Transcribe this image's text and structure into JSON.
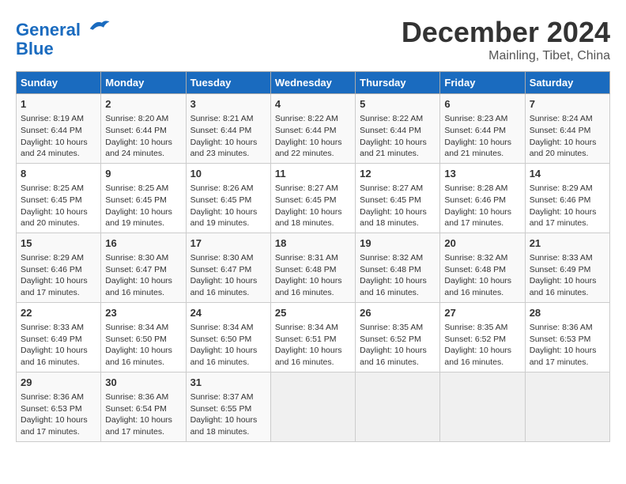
{
  "header": {
    "logo_line1": "General",
    "logo_line2": "Blue",
    "month": "December 2024",
    "location": "Mainling, Tibet, China"
  },
  "weekdays": [
    "Sunday",
    "Monday",
    "Tuesday",
    "Wednesday",
    "Thursday",
    "Friday",
    "Saturday"
  ],
  "weeks": [
    [
      {
        "day": "1",
        "info": "Sunrise: 8:19 AM\nSunset: 6:44 PM\nDaylight: 10 hours and 24 minutes."
      },
      {
        "day": "2",
        "info": "Sunrise: 8:20 AM\nSunset: 6:44 PM\nDaylight: 10 hours and 24 minutes."
      },
      {
        "day": "3",
        "info": "Sunrise: 8:21 AM\nSunset: 6:44 PM\nDaylight: 10 hours and 23 minutes."
      },
      {
        "day": "4",
        "info": "Sunrise: 8:22 AM\nSunset: 6:44 PM\nDaylight: 10 hours and 22 minutes."
      },
      {
        "day": "5",
        "info": "Sunrise: 8:22 AM\nSunset: 6:44 PM\nDaylight: 10 hours and 21 minutes."
      },
      {
        "day": "6",
        "info": "Sunrise: 8:23 AM\nSunset: 6:44 PM\nDaylight: 10 hours and 21 minutes."
      },
      {
        "day": "7",
        "info": "Sunrise: 8:24 AM\nSunset: 6:44 PM\nDaylight: 10 hours and 20 minutes."
      }
    ],
    [
      {
        "day": "8",
        "info": "Sunrise: 8:25 AM\nSunset: 6:45 PM\nDaylight: 10 hours and 20 minutes."
      },
      {
        "day": "9",
        "info": "Sunrise: 8:25 AM\nSunset: 6:45 PM\nDaylight: 10 hours and 19 minutes."
      },
      {
        "day": "10",
        "info": "Sunrise: 8:26 AM\nSunset: 6:45 PM\nDaylight: 10 hours and 19 minutes."
      },
      {
        "day": "11",
        "info": "Sunrise: 8:27 AM\nSunset: 6:45 PM\nDaylight: 10 hours and 18 minutes."
      },
      {
        "day": "12",
        "info": "Sunrise: 8:27 AM\nSunset: 6:45 PM\nDaylight: 10 hours and 18 minutes."
      },
      {
        "day": "13",
        "info": "Sunrise: 8:28 AM\nSunset: 6:46 PM\nDaylight: 10 hours and 17 minutes."
      },
      {
        "day": "14",
        "info": "Sunrise: 8:29 AM\nSunset: 6:46 PM\nDaylight: 10 hours and 17 minutes."
      }
    ],
    [
      {
        "day": "15",
        "info": "Sunrise: 8:29 AM\nSunset: 6:46 PM\nDaylight: 10 hours and 17 minutes."
      },
      {
        "day": "16",
        "info": "Sunrise: 8:30 AM\nSunset: 6:47 PM\nDaylight: 10 hours and 16 minutes."
      },
      {
        "day": "17",
        "info": "Sunrise: 8:30 AM\nSunset: 6:47 PM\nDaylight: 10 hours and 16 minutes."
      },
      {
        "day": "18",
        "info": "Sunrise: 8:31 AM\nSunset: 6:48 PM\nDaylight: 10 hours and 16 minutes."
      },
      {
        "day": "19",
        "info": "Sunrise: 8:32 AM\nSunset: 6:48 PM\nDaylight: 10 hours and 16 minutes."
      },
      {
        "day": "20",
        "info": "Sunrise: 8:32 AM\nSunset: 6:48 PM\nDaylight: 10 hours and 16 minutes."
      },
      {
        "day": "21",
        "info": "Sunrise: 8:33 AM\nSunset: 6:49 PM\nDaylight: 10 hours and 16 minutes."
      }
    ],
    [
      {
        "day": "22",
        "info": "Sunrise: 8:33 AM\nSunset: 6:49 PM\nDaylight: 10 hours and 16 minutes."
      },
      {
        "day": "23",
        "info": "Sunrise: 8:34 AM\nSunset: 6:50 PM\nDaylight: 10 hours and 16 minutes."
      },
      {
        "day": "24",
        "info": "Sunrise: 8:34 AM\nSunset: 6:50 PM\nDaylight: 10 hours and 16 minutes."
      },
      {
        "day": "25",
        "info": "Sunrise: 8:34 AM\nSunset: 6:51 PM\nDaylight: 10 hours and 16 minutes."
      },
      {
        "day": "26",
        "info": "Sunrise: 8:35 AM\nSunset: 6:52 PM\nDaylight: 10 hours and 16 minutes."
      },
      {
        "day": "27",
        "info": "Sunrise: 8:35 AM\nSunset: 6:52 PM\nDaylight: 10 hours and 16 minutes."
      },
      {
        "day": "28",
        "info": "Sunrise: 8:36 AM\nSunset: 6:53 PM\nDaylight: 10 hours and 17 minutes."
      }
    ],
    [
      {
        "day": "29",
        "info": "Sunrise: 8:36 AM\nSunset: 6:53 PM\nDaylight: 10 hours and 17 minutes."
      },
      {
        "day": "30",
        "info": "Sunrise: 8:36 AM\nSunset: 6:54 PM\nDaylight: 10 hours and 17 minutes."
      },
      {
        "day": "31",
        "info": "Sunrise: 8:37 AM\nSunset: 6:55 PM\nDaylight: 10 hours and 18 minutes."
      },
      {
        "day": "",
        "info": ""
      },
      {
        "day": "",
        "info": ""
      },
      {
        "day": "",
        "info": ""
      },
      {
        "day": "",
        "info": ""
      }
    ]
  ]
}
